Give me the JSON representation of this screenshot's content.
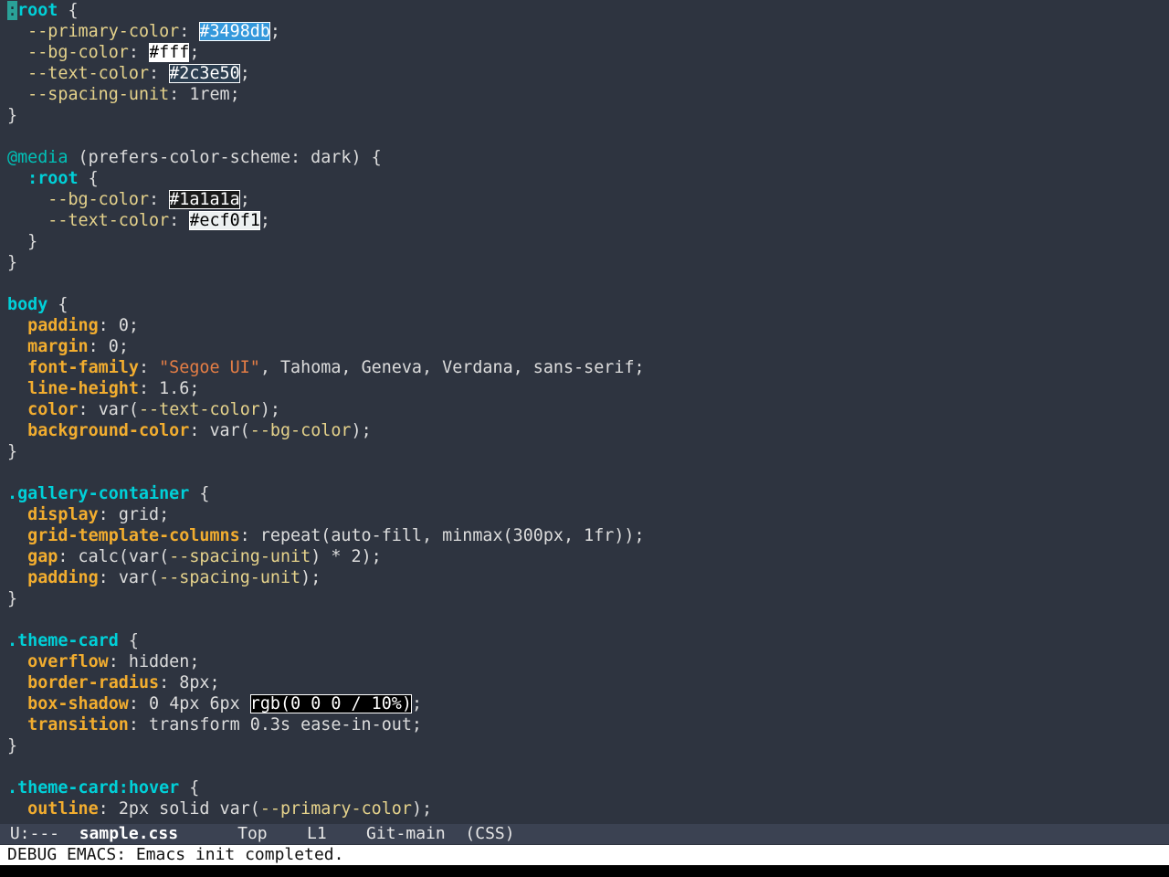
{
  "colors": {
    "background": "#2e3440",
    "selector": "#00d0d8",
    "property": "#f2ad2f",
    "variable": "#e5d28b",
    "string": "#e67e45",
    "swatch_primary": "#3498db",
    "swatch_bg": "#fff",
    "swatch_text": "#2c3e50",
    "swatch_dark_bg": "#1a1a1a",
    "swatch_dark_text": "#ecf0f1",
    "swatch_shadow": "#000000"
  },
  "code": {
    "root": {
      "sel": "root",
      "cursor_char": ":",
      "open": " {",
      "primary_name": "--primary-color",
      "primary_val": "#3498db",
      "bg_name": "--bg-color",
      "bg_val": "#fff",
      "text_name": "--text-color",
      "text_val": "#2c3e50",
      "spacing_name": "--spacing-unit",
      "spacing_val": "1rem"
    },
    "media": {
      "at": "@media",
      "query": " (prefers-color-scheme: dark) {",
      "inner_sel": ":root",
      "bg_name": "--bg-color",
      "bg_val": "#1a1a1a",
      "text_name": "--text-color",
      "text_val": "#ecf0f1"
    },
    "body": {
      "sel": "body",
      "padding_prop": "padding",
      "padding_val": "0",
      "margin_prop": "margin",
      "margin_val": "0",
      "font_prop": "font-family",
      "font_str": "\"Segoe UI\"",
      "font_rest": ", Tahoma, Geneva, Verdana, sans-serif",
      "lh_prop": "line-height",
      "lh_val": "1.6",
      "color_prop": "color",
      "color_fn": "var(",
      "color_var": "--text-color",
      "bgc_prop": "background-color",
      "bgc_fn": "var(",
      "bgc_var": "--bg-color"
    },
    "gallery": {
      "sel": ".gallery-container",
      "display_prop": "display",
      "display_val": "grid",
      "gtc_prop": "grid-template-columns",
      "gtc_val": "repeat(auto-fill, minmax(300px, 1fr))",
      "gap_prop": "gap",
      "gap_pre": "calc(var(",
      "gap_var": "--spacing-unit",
      "gap_post": ") * 2)",
      "pad_prop": "padding",
      "pad_fn": "var(",
      "pad_var": "--spacing-unit"
    },
    "card": {
      "sel": ".theme-card",
      "overflow_prop": "overflow",
      "overflow_val": "hidden",
      "br_prop": "border-radius",
      "br_val": "8px",
      "bs_prop": "box-shadow",
      "bs_pre": "0 4px 6px ",
      "bs_rgb": "rgb(0 0 0 / 10%)",
      "tr_prop": "transition",
      "tr_val": "transform 0.3s ease-in-out"
    },
    "hover": {
      "sel": ".theme-card:hover",
      "outline_prop": "outline",
      "outline_pre": "2px solid var(",
      "outline_var": "--primary-color"
    }
  },
  "modeline": {
    "state": " U:---  ",
    "buffer": "sample.css",
    "position": "Top",
    "line": "L1",
    "vc": "Git-main",
    "mode": "(CSS)"
  },
  "echo_area": {
    "message": "DEBUG EMACS: Emacs init completed."
  }
}
